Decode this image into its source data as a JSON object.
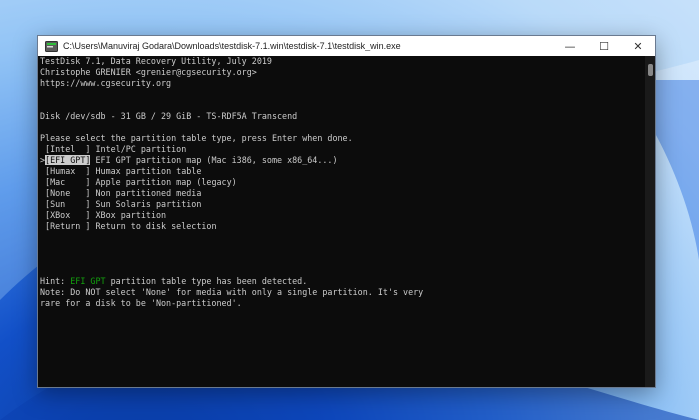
{
  "window": {
    "title": "C:\\Users\\Manuviraj Godara\\Downloads\\testdisk-7.1.win\\testdisk-7.1\\testdisk_win.exe",
    "minimize_glyph": "—",
    "maximize_glyph": "☐",
    "close_glyph": "✕"
  },
  "console": {
    "header": [
      "TestDisk 7.1, Data Recovery Utility, July 2019",
      "Christophe GRENIER <grenier@cgsecurity.org>",
      "https://www.cgsecurity.org"
    ],
    "disk_info": "Disk /dev/sdb - 31 GB / 29 GiB - TS-RDF5A Transcend",
    "prompt": "Please select the partition table type, press Enter when done.",
    "options": [
      {
        "prefix": " ",
        "key": "[Intel  ]",
        "desc": " Intel/PC partition"
      },
      {
        "prefix": ">",
        "key": "[EFI GPT]",
        "desc": " EFI GPT partition map (Mac i386, some x86_64...)"
      },
      {
        "prefix": " ",
        "key": "[Humax  ]",
        "desc": " Humax partition table"
      },
      {
        "prefix": " ",
        "key": "[Mac    ]",
        "desc": " Apple partition map (legacy)"
      },
      {
        "prefix": " ",
        "key": "[None   ]",
        "desc": " Non partitioned media"
      },
      {
        "prefix": " ",
        "key": "[Sun    ]",
        "desc": " Sun Solaris partition"
      },
      {
        "prefix": " ",
        "key": "[XBox   ]",
        "desc": " XBox partition"
      },
      {
        "prefix": " ",
        "key": "[Return ]",
        "desc": " Return to disk selection"
      }
    ],
    "selected_index": 1,
    "hint_prefix": "Hint: ",
    "hint_highlight": "EFI GPT",
    "hint_suffix": " partition table type has been detected.",
    "note_line1": "Note: Do NOT select 'None' for media with only a single partition. It's very",
    "note_line2": "rare for a disk to be 'Non-partitioned'."
  },
  "colors": {
    "console_bg": "#0c0c0c",
    "console_text": "#cccccc",
    "hint_green": "#13a10e"
  }
}
